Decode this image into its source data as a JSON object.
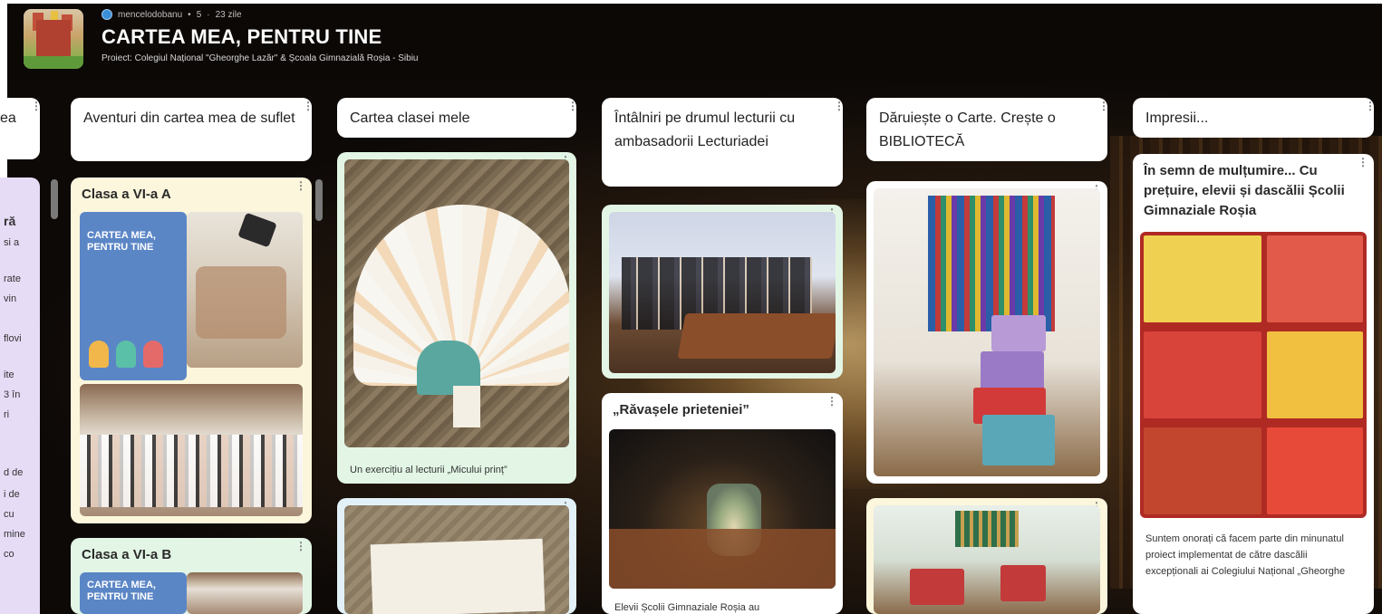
{
  "board": {
    "author": "mencelodobanu",
    "likes": "5",
    "age": "23 zile",
    "title": "CARTEA MEA, PENTRU TINE",
    "subtitle": "Proiect: Colegiul Național \"Gheorghe Lazăr\" & Școala Gimnazială Roșia - Sibiu"
  },
  "colors": {
    "header_bg": "#0c0806",
    "card_purple": "#e7dcf6",
    "card_yellow": "#fbf6dc",
    "card_green": "#e3f6e6",
    "card_blue": "#e2f1f8"
  },
  "columns": [
    {
      "title": "ea"
    },
    {
      "title": "Aventuri din cartea mea de suflet"
    },
    {
      "title": "Cartea clasei mele"
    },
    {
      "title": "Întâlniri pe drumul lecturii cu ambasadorii Lecturiadei"
    },
    {
      "title": "Dăruiește o Carte. Crește o BIBLIOTECĂ"
    },
    {
      "title": "Impresii..."
    }
  ],
  "left_fragments": [
    "ră",
    "si a",
    "rate",
    "vin",
    "flovi",
    "ite",
    "3 în",
    "ri",
    "d de",
    "i de",
    "cu",
    "mine",
    "co"
  ],
  "cards": {
    "clasa6a": {
      "title": "Clasa a VI-a A"
    },
    "clasa6b": {
      "title": "Clasa a VI-a B"
    },
    "poster_text": "CARTEA MEA, PENTRU TINE",
    "cartea_clasei_caption": "Un exercițiu al lecturii „Micului prinț”",
    "ravasele": {
      "title": "„Răvașele prieteniei”",
      "caption": "Elevii Școlii Gimnaziale Roșia au"
    },
    "impresii": {
      "title": "În semn de mulțumire... Cu prețuire, elevii și dascălii Școlii Gimnaziale Roșia",
      "caption": "Suntem onorați că facem parte din minunatul proiect implementat de către dascălii excepționali ai Colegiului Național „Gheorghe"
    }
  },
  "icons": [
    "globe-icon",
    "heart-icon",
    "more-options-icon"
  ]
}
